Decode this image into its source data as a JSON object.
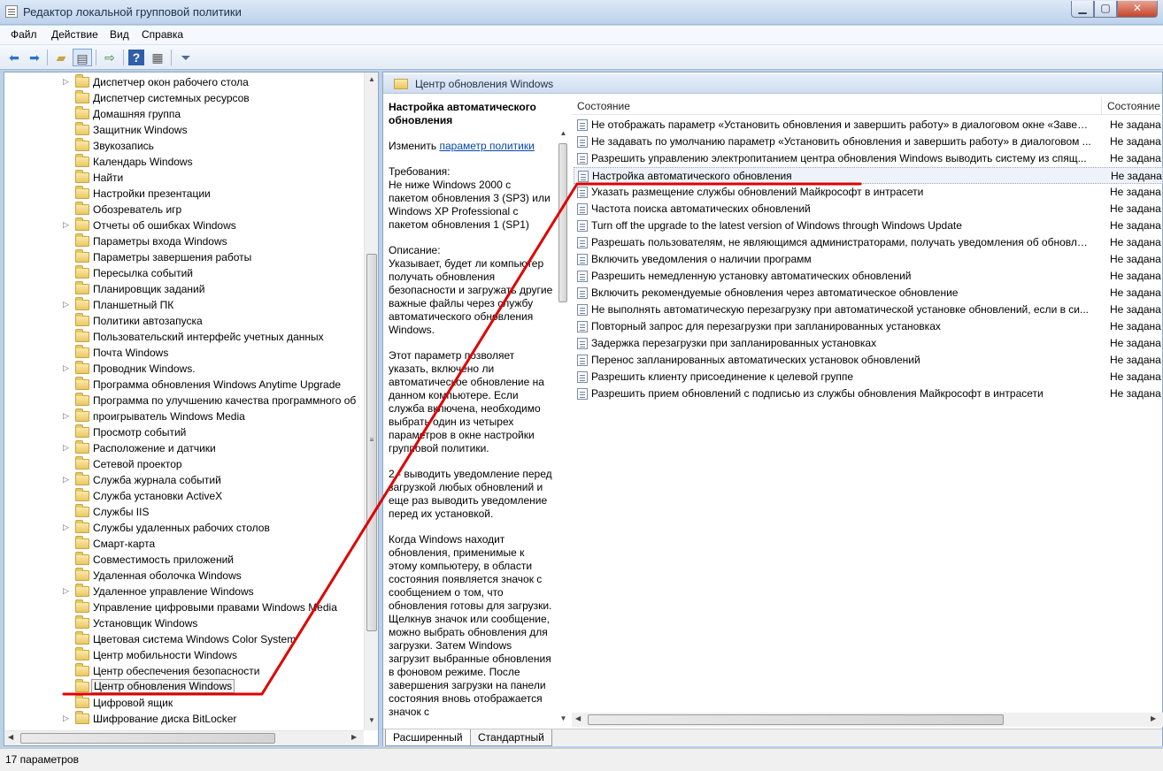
{
  "window": {
    "title": "Редактор локальной групповой политики",
    "min_glyph": "▁",
    "max_glyph": "▢",
    "close_glyph": "✕"
  },
  "menu": [
    "Файл",
    "Действие",
    "Вид",
    "Справка"
  ],
  "toolbar_icons": [
    "back-icon",
    "forward-icon",
    "up-folder-icon",
    "show-hide-tree-icon",
    "export-list-icon",
    "help-icon",
    "properties-icon",
    "filter-icon"
  ],
  "tree": {
    "items": [
      {
        "label": "Диспетчер окон рабочего стола",
        "expandable": true
      },
      {
        "label": "Диспетчер системных ресурсов",
        "expandable": false
      },
      {
        "label": "Домашняя группа",
        "expandable": false
      },
      {
        "label": "Защитник Windows",
        "expandable": false
      },
      {
        "label": "Звукозапись",
        "expandable": false
      },
      {
        "label": "Календарь Windows",
        "expandable": false
      },
      {
        "label": "Найти",
        "expandable": false
      },
      {
        "label": "Настройки презентации",
        "expandable": false
      },
      {
        "label": "Обозреватель игр",
        "expandable": false
      },
      {
        "label": "Отчеты об ошибках Windows",
        "expandable": true
      },
      {
        "label": "Параметры входа Windows",
        "expandable": false
      },
      {
        "label": "Параметры завершения работы",
        "expandable": false
      },
      {
        "label": "Пересылка событий",
        "expandable": false
      },
      {
        "label": "Планировщик заданий",
        "expandable": false
      },
      {
        "label": "Планшетный ПК",
        "expandable": true
      },
      {
        "label": "Политики автозапуска",
        "expandable": false
      },
      {
        "label": "Пользовательский интерфейс учетных данных",
        "expandable": false
      },
      {
        "label": "Почта Windows",
        "expandable": false
      },
      {
        "label": "Проводник Windows.",
        "expandable": true
      },
      {
        "label": "Программа обновления Windows Anytime Upgrade",
        "expandable": false
      },
      {
        "label": "Программа по улучшению качества программного об",
        "expandable": false
      },
      {
        "label": "проигрыватель Windows Media",
        "expandable": true
      },
      {
        "label": "Просмотр событий",
        "expandable": false
      },
      {
        "label": "Расположение и датчики",
        "expandable": true
      },
      {
        "label": "Сетевой проектор",
        "expandable": false
      },
      {
        "label": "Служба журнала событий",
        "expandable": true
      },
      {
        "label": "Служба установки ActiveX",
        "expandable": false
      },
      {
        "label": "Службы IIS",
        "expandable": false
      },
      {
        "label": "Службы удаленных рабочих столов",
        "expandable": true
      },
      {
        "label": "Смарт-карта",
        "expandable": false
      },
      {
        "label": "Совместимость приложений",
        "expandable": false
      },
      {
        "label": "Удаленная оболочка Windows",
        "expandable": false
      },
      {
        "label": "Удаленное управление Windows",
        "expandable": true
      },
      {
        "label": "Управление цифровыми правами Windows Media",
        "expandable": false
      },
      {
        "label": "Установщик Windows",
        "expandable": false
      },
      {
        "label": "Цветовая система Windows Color System",
        "expandable": false
      },
      {
        "label": "Центр мобильности Windows",
        "expandable": false
      },
      {
        "label": "Центр обеспечения безопасности",
        "expandable": false
      },
      {
        "label": "Центр обновления Windows",
        "expandable": false,
        "selected": true
      },
      {
        "label": "Цифровой ящик",
        "expandable": false
      },
      {
        "label": "Шифрование диска BitLocker",
        "expandable": true
      }
    ]
  },
  "right": {
    "header_title": "Центр обновления Windows",
    "description": {
      "title": "Настройка автоматического обновления",
      "edit_prefix": "Изменить ",
      "edit_link": "параметр политики",
      "paragraphs": [
        "Требования:\nНе ниже Windows 2000 с пакетом обновления 3 (SP3) или Windows XP Professional с пакетом обновления 1 (SP1)",
        "Описание:\nУказывает, будет ли компьютер получать обновления безопасности и загружать другие важные файлы через службу автоматического обновления Windows.",
        "Этот параметр позволяет указать, включено ли автоматическое обновление на данном компьютере. Если служба включена, необходимо выбрать один из четырех параметров в окне настройки групповой политики.",
        "2 - выводить уведомление перед загрузкой любых обновлений и еще раз выводить уведомление перед их установкой.",
        "Когда Windows находит обновления, применимые к этому компьютеру, в области состояния появляется значок с сообщением о том, что обновления готовы для загрузки. Щелкнув значок или сообщение, можно выбрать обновления для загрузки. Затем Windows загрузит выбранные обновления в фоновом режиме. После завершения загрузки на панели состояния вновь отображается значок с"
      ]
    },
    "columns": [
      "Состояние",
      "Состояние"
    ],
    "rows": [
      {
        "name": "Не отображать параметр «Установить обновления и завершить работу» в диалоговом окне «Завер...",
        "state": "Не задана"
      },
      {
        "name": "Не задавать по умолчанию параметр «Установить обновления и завершить работу» в диалоговом ...",
        "state": "Не задана"
      },
      {
        "name": "Разрешить управлению электропитанием центра обновления Windows выводить систему из спящ...",
        "state": "Не задана"
      },
      {
        "name": "Настройка автоматического обновления",
        "state": "Не задана",
        "selected": true
      },
      {
        "name": "Указать размещение службы обновлений Майкрософт в интрасети",
        "state": "Не задана"
      },
      {
        "name": "Частота поиска автоматических обновлений",
        "state": "Не задана"
      },
      {
        "name": "Turn off the upgrade to the latest version of Windows through Windows Update",
        "state": "Не задана"
      },
      {
        "name": "Разрешать пользователям, не являющимся администраторами, получать уведомления об обновле...",
        "state": "Не задана"
      },
      {
        "name": "Включить уведомления о наличии программ",
        "state": "Не задана"
      },
      {
        "name": "Разрешить немедленную установку автоматических обновлений",
        "state": "Не задана"
      },
      {
        "name": "Включить рекомендуемые обновления через автоматическое обновление",
        "state": "Не задана"
      },
      {
        "name": "Не выполнять автоматическую перезагрузку при автоматической установке обновлений, если в си...",
        "state": "Не задана"
      },
      {
        "name": "Повторный запрос для перезагрузки при запланированных установках",
        "state": "Не задана"
      },
      {
        "name": "Задержка перезагрузки при запланированных установках",
        "state": "Не задана"
      },
      {
        "name": "Перенос запланированных автоматических установок обновлений",
        "state": "Не задана"
      },
      {
        "name": "Разрешить клиенту присоединение к целевой группе",
        "state": "Не задана"
      },
      {
        "name": "Разрешить прием обновлений с подписью из службы обновления Майкрософт в интрасети",
        "state": "Не задана"
      }
    ],
    "tabs": [
      "Расширенный",
      "Стандартный"
    ]
  },
  "status": "17 параметров",
  "colors": {
    "annotation": "#e00000",
    "selected_bg": "#eef3fb",
    "link": "#0645ad"
  }
}
